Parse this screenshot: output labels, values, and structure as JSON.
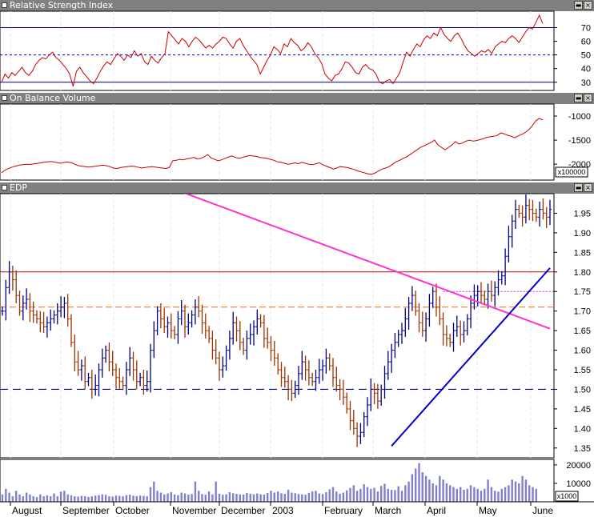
{
  "panels": {
    "rsi": {
      "title": "Relative Strength Index"
    },
    "obv": {
      "title": "On Balance Volume",
      "unit_label": "x100000"
    },
    "price": {
      "title": "EDP"
    },
    "volume": {
      "unit_label": "x1000"
    }
  },
  "colors": {
    "title_bar": "#808080",
    "indicator_line": "#cc0000",
    "up_bar": "#000080",
    "down_bar": "#993300",
    "downtrend_line": "#ff33cc",
    "uptrend_line": "#0000cc",
    "volume_bars": "#8080cc",
    "resistance": "#cc0000",
    "support": "#0000aa"
  },
  "x_axis": {
    "labels": [
      "August",
      "September",
      "October",
      "November",
      "December",
      "2003",
      "February",
      "March",
      "April",
      "May",
      "June"
    ]
  },
  "chart_data": [
    {
      "type": "line",
      "name": "Relative Strength Index",
      "y_ticks": [
        30,
        40,
        50,
        60,
        70
      ],
      "ylim": [
        24,
        82
      ],
      "reference_lines": [
        30,
        50,
        70
      ],
      "values": [
        30,
        36,
        33,
        37,
        35,
        38,
        41,
        37,
        35,
        38,
        43,
        46,
        48,
        47,
        50,
        52,
        48,
        46,
        43,
        40,
        36,
        27,
        38,
        41,
        37,
        34,
        31,
        29,
        33,
        38,
        42,
        45,
        43,
        47,
        51,
        49,
        46,
        50,
        48,
        53,
        49,
        51,
        45,
        43,
        49,
        46,
        44,
        48,
        51,
        67,
        64,
        61,
        58,
        62,
        60,
        56,
        60,
        63,
        61,
        58,
        55,
        57,
        55,
        58,
        60,
        63,
        62,
        58,
        55,
        60,
        62,
        57,
        53,
        49,
        46,
        43,
        36,
        41,
        46,
        50,
        56,
        54,
        51,
        58,
        56,
        62,
        59,
        57,
        53,
        55,
        59,
        56,
        51,
        48,
        44,
        36,
        33,
        31,
        35,
        36,
        40,
        45,
        44,
        41,
        37,
        36,
        41,
        43,
        40,
        39,
        36,
        30,
        29,
        31,
        32,
        29,
        33,
        37,
        45,
        52,
        49,
        54,
        58,
        56,
        61,
        64,
        62,
        66,
        64,
        70,
        65,
        62,
        60,
        64,
        66,
        62,
        57,
        53,
        51,
        49,
        51,
        53,
        52,
        54,
        51,
        56,
        58,
        60,
        59,
        62,
        64,
        62,
        59,
        63,
        67,
        70,
        69,
        74,
        79,
        73
      ]
    },
    {
      "type": "line",
      "name": "On Balance Volume",
      "y_ticks": [
        -2000,
        -1500,
        -1000
      ],
      "ylim": [
        -2330,
        -750
      ],
      "values": [
        -2180,
        -2120,
        -2090,
        -2060,
        -2040,
        -2020,
        -2010,
        -2000,
        -2005,
        -1995,
        -1985,
        -1975,
        -1960,
        -1950,
        -1945,
        -1950,
        -1970,
        -1980,
        -1960,
        -1955,
        -1970,
        -2000,
        -2030,
        -2040,
        -2050,
        -2060,
        -2050,
        -2040,
        -2030,
        -2020,
        -2030,
        -2050,
        -2080,
        -2090,
        -2070,
        -2060,
        -2050,
        -2040,
        -2045,
        -2060,
        -2080,
        -2070,
        -2060,
        -2050,
        -2060,
        -2070,
        -2080,
        -2090,
        -2070,
        -1930,
        -1920,
        -1900,
        -1910,
        -1890,
        -1880,
        -1860,
        -1890,
        -1880,
        -1850,
        -1800,
        -1870,
        -1900,
        -1930,
        -1910,
        -1880,
        -1850,
        -1830,
        -1860,
        -1880,
        -1860,
        -1840,
        -1820,
        -1830,
        -1840,
        -1860,
        -1870,
        -1880,
        -1900,
        -1920,
        -1950,
        -1960,
        -1980,
        -2000,
        -1990,
        -1970,
        -1990,
        -1960,
        -1980,
        -2000,
        -2010,
        -1990,
        -1970,
        -2010,
        -2040,
        -2070,
        -2100,
        -2080,
        -2050,
        -2060,
        -2070,
        -2090,
        -2110,
        -2140,
        -2160,
        -2180,
        -2200,
        -2210,
        -2180,
        -2140,
        -2100,
        -2080,
        -2050,
        -2000,
        -1950,
        -1920,
        -1880,
        -1850,
        -1800,
        -1750,
        -1700,
        -1650,
        -1620,
        -1580,
        -1550,
        -1500,
        -1600,
        -1650,
        -1700,
        -1650,
        -1600,
        -1530,
        -1580,
        -1560,
        -1520,
        -1500,
        -1520,
        -1510,
        -1490,
        -1470,
        -1440,
        -1430,
        -1420,
        -1400,
        -1350,
        -1370,
        -1400,
        -1420,
        -1450,
        -1410,
        -1380,
        -1340,
        -1280,
        -1200,
        -1100,
        -1050,
        -1080
      ]
    },
    {
      "type": "candlestick",
      "name": "EDP",
      "y_ticks": [
        1.35,
        1.4,
        1.45,
        1.5,
        1.55,
        1.6,
        1.65,
        1.7,
        1.75,
        1.8,
        1.85,
        1.9,
        1.95
      ],
      "ylim": [
        1.325,
        2.0
      ],
      "reference_lines": [
        {
          "label": "resistance",
          "value": 1.8,
          "style": "solid"
        },
        {
          "label": "resistance",
          "value": 1.71,
          "style": "dashed"
        },
        {
          "label": "support",
          "value": 1.5,
          "style": "dashed"
        },
        {
          "label": "resistance",
          "value": 1.75,
          "style": "dotted"
        }
      ],
      "trend_lines": [
        {
          "name": "downtrend",
          "from": [
            35,
            2.06
          ],
          "to": [
            159,
            1.655
          ]
        },
        {
          "name": "uptrend",
          "from": [
            113,
            1.355
          ],
          "to": [
            159,
            1.81
          ]
        }
      ],
      "close": [
        1.7,
        1.76,
        1.8,
        1.78,
        1.74,
        1.7,
        1.72,
        1.73,
        1.7,
        1.69,
        1.68,
        1.67,
        1.66,
        1.67,
        1.68,
        1.69,
        1.7,
        1.71,
        1.72,
        1.68,
        1.62,
        1.57,
        1.55,
        1.56,
        1.52,
        1.53,
        1.5,
        1.51,
        1.55,
        1.58,
        1.6,
        1.57,
        1.55,
        1.53,
        1.52,
        1.51,
        1.55,
        1.58,
        1.55,
        1.52,
        1.53,
        1.51,
        1.52,
        1.6,
        1.65,
        1.7,
        1.68,
        1.66,
        1.67,
        1.65,
        1.64,
        1.68,
        1.7,
        1.66,
        1.67,
        1.69,
        1.71,
        1.7,
        1.67,
        1.65,
        1.63,
        1.6,
        1.58,
        1.55,
        1.56,
        1.6,
        1.63,
        1.67,
        1.65,
        1.62,
        1.6,
        1.63,
        1.64,
        1.66,
        1.68,
        1.67,
        1.63,
        1.62,
        1.6,
        1.58,
        1.55,
        1.53,
        1.52,
        1.5,
        1.49,
        1.51,
        1.54,
        1.57,
        1.55,
        1.53,
        1.52,
        1.53,
        1.55,
        1.56,
        1.58,
        1.56,
        1.53,
        1.51,
        1.5,
        1.48,
        1.45,
        1.42,
        1.4,
        1.38,
        1.39,
        1.43,
        1.46,
        1.5,
        1.49,
        1.47,
        1.5,
        1.54,
        1.57,
        1.6,
        1.62,
        1.64,
        1.65,
        1.68,
        1.72,
        1.74,
        1.7,
        1.67,
        1.65,
        1.68,
        1.72,
        1.75,
        1.71,
        1.68,
        1.64,
        1.63,
        1.62,
        1.65,
        1.66,
        1.64,
        1.65,
        1.68,
        1.72,
        1.74,
        1.75,
        1.74,
        1.73,
        1.75,
        1.74,
        1.76,
        1.78,
        1.79,
        1.84,
        1.89,
        1.93,
        1.96,
        1.95,
        1.94,
        1.97,
        1.96,
        1.95,
        1.94,
        1.96,
        1.95,
        1.94,
        1.96
      ],
      "volume_y_ticks": [
        10000,
        20000
      ],
      "volume_ylim": [
        0,
        23000
      ],
      "volume": [
        4000,
        7000,
        5000,
        3000,
        6000,
        4000,
        3000,
        5000,
        4000,
        3000,
        2500,
        4000,
        3000,
        3500,
        3000,
        4500,
        3000,
        5500,
        6000,
        4000,
        3500,
        3000,
        2800,
        3200,
        3000,
        2600,
        3000,
        3400,
        3600,
        4000,
        3800,
        3000,
        2800,
        3400,
        3200,
        3000,
        3600,
        3800,
        3300,
        3100,
        3400,
        3200,
        3000,
        8000,
        11000,
        6000,
        5000,
        4000,
        4500,
        5200,
        4000,
        3600,
        5000,
        4500,
        3900,
        4200,
        11000,
        6000,
        4200,
        3800,
        5600,
        4000,
        11000,
        4400,
        3800,
        4100,
        5200,
        4600,
        4300,
        4000,
        3900,
        4800,
        4400,
        4100,
        4500,
        4100,
        3900,
        4800,
        6000,
        5000,
        5600,
        4600,
        4300,
        6500,
        5000,
        4600,
        4200,
        4000,
        3800,
        4800,
        5600,
        6000,
        4500,
        4200,
        5200,
        6800,
        8000,
        5600,
        4400,
        5000,
        6200,
        7500,
        9000,
        6000,
        7000,
        9500,
        8000,
        7000,
        7600,
        5600,
        8600,
        9800,
        7000,
        6500,
        6400,
        8400,
        6000,
        9000,
        11000,
        15000,
        18000,
        21000,
        16000,
        14000,
        12000,
        10000,
        9000,
        14000,
        12000,
        10000,
        9000,
        8000,
        7000,
        8000,
        6500,
        7000,
        9000,
        8000,
        7000,
        6000,
        7000,
        12000,
        8000,
        6000,
        5500,
        7000,
        8000,
        9000,
        12000,
        11000,
        10000,
        14000,
        12000,
        9000,
        8000,
        7000
      ]
    }
  ]
}
